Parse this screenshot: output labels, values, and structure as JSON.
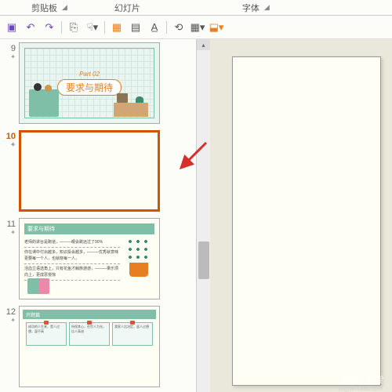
{
  "ribbon": {
    "sections": [
      "剪贴板",
      "幻灯片",
      "字体"
    ]
  },
  "toolbar": {
    "save": "💾",
    "undo": "↶",
    "redo": "↷"
  },
  "slides": {
    "s9": {
      "num": "9",
      "part": "Part 02",
      "title": "要求与期待"
    },
    "s10": {
      "num": "10"
    },
    "s11": {
      "num": "11",
      "header": "要求与期待",
      "lines": [
        "老师的讲台是跑道，———眼会跳远过了90%",
        "你在课中付出越多，知识投会越多，———优秀就意味更要每一个人，也就晓每一人，",
        "活血立语选角上，只有花鱼才躺族游游，———果乐项向上，更成思悦惊"
      ]
    },
    "s12": {
      "num": "12",
      "header": "开题篇",
      "card1": "成功的人生来，是人过想，虽不高",
      "card2": "所保其心，在世人为光，比人高流",
      "card3": "我家人比决定，虽人过想"
    }
  },
  "watermark": {
    "main": "Baidu 经验",
    "sub": "jingyan.baidu.com"
  }
}
